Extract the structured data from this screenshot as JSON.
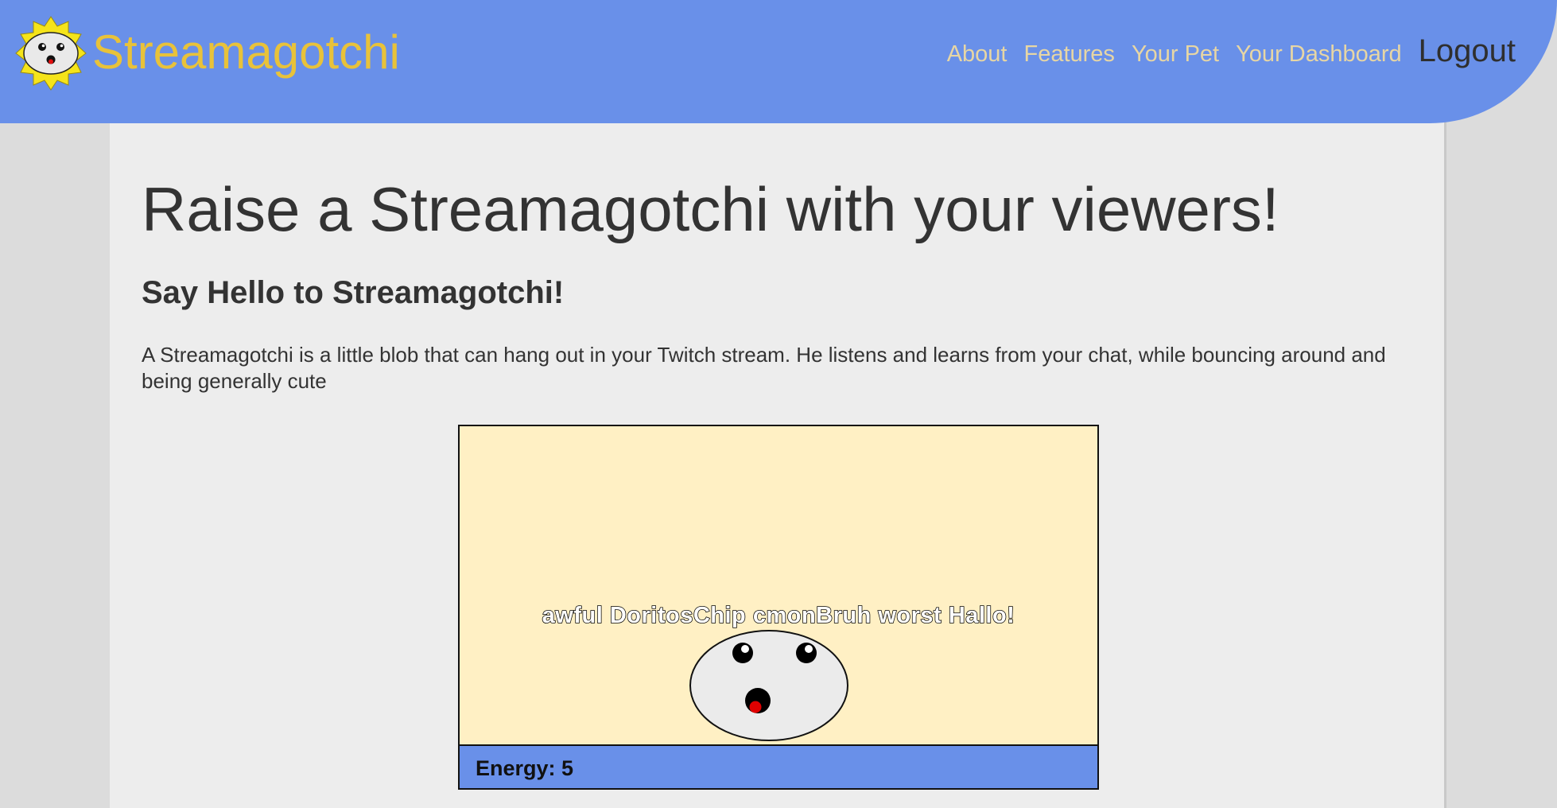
{
  "header": {
    "brand": "Streamagotchi",
    "logo_icon": "streamagotchi-sun-logo-icon",
    "colors": {
      "background": "#6990e9",
      "brand": "#e8c23a",
      "nav": "#e7d6a4"
    }
  },
  "nav": {
    "items": [
      {
        "label": "About"
      },
      {
        "label": "Features"
      },
      {
        "label": "Your Pet"
      },
      {
        "label": "Your Dashboard"
      }
    ],
    "logout_label": "Logout"
  },
  "main": {
    "title": "Raise a Streamagotchi with your viewers!",
    "subtitle": "Say Hello to Streamagotchi!",
    "description": "A Streamagotchi is a little blob that can hang out in your Twitch stream. He listens and learns from your chat, while bouncing around and being generally cute"
  },
  "pet": {
    "chat_line": "awful DoritosChip cmonBruh worst Hallo!",
    "energy_label": "Energy: 5",
    "colors": {
      "stage": "#fff0c4",
      "energy_bar": "#6990e9"
    }
  }
}
